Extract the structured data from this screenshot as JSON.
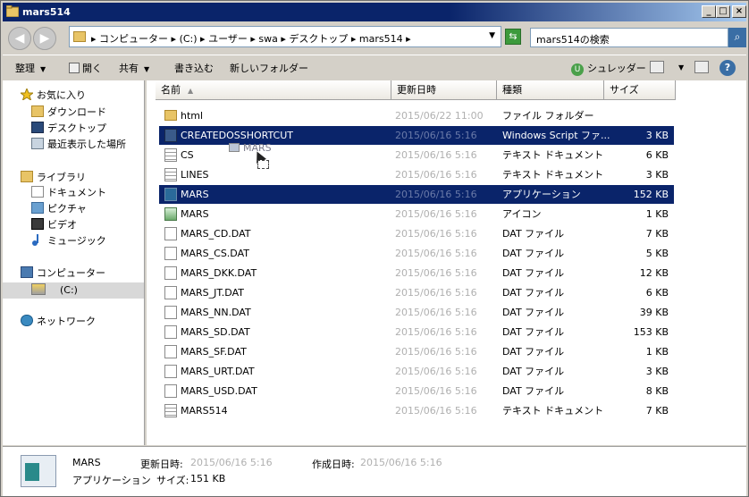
{
  "window": {
    "title": "mars514"
  },
  "titlebar_buttons": {
    "minimize": "_",
    "maximize": "□",
    "close": "×"
  },
  "address": {
    "crumbs": [
      "コンピューター",
      "(C:)",
      "ユーザー",
      "swa",
      "デスクトップ",
      "mars514"
    ],
    "search_placeholder": "mars514の検索"
  },
  "toolbar": {
    "organize": "整理",
    "open": "開く",
    "share": "共有",
    "burn": "書き込む",
    "new_folder": "新しいフォルダー",
    "shredder": "シュレッダー"
  },
  "nav": {
    "favorites": "お気に入り",
    "downloads": "ダウンロード",
    "desktop": "デスクトップ",
    "recent": "最近表示した場所",
    "libraries": "ライブラリ",
    "documents": "ドキュメント",
    "pictures": "ピクチャ",
    "videos": "ビデオ",
    "music": "ミュージック",
    "computer": "コンピューター",
    "drive_c": "(C:)",
    "network": "ネットワーク"
  },
  "columns": {
    "name": "名前",
    "date": "更新日時",
    "type": "種類",
    "size": "サイズ"
  },
  "files": [
    {
      "name": "html",
      "date": "2015/06/22 11:00",
      "type": "ファイル フォルダー",
      "size": "",
      "icon": "folder-icon",
      "selected": false
    },
    {
      "name": "CREATEDOSSHORTCUT",
      "date": "2015/06/16 5:16",
      "type": "Windows Script ファ...",
      "size": "3 KB",
      "icon": "script-icon",
      "selected": true
    },
    {
      "name": "CS",
      "date": "2015/06/16 5:16",
      "type": "テキスト ドキュメント",
      "size": "6 KB",
      "icon": "text-file-icon",
      "selected": false
    },
    {
      "name": "LINES",
      "date": "2015/06/16 5:16",
      "type": "テキスト ドキュメント",
      "size": "3 KB",
      "icon": "text-file-icon",
      "selected": false
    },
    {
      "name": "MARS",
      "date": "2015/06/16 5:16",
      "type": "アプリケーション",
      "size": "152 KB",
      "icon": "application-icon",
      "selected": true
    },
    {
      "name": "MARS",
      "date": "2015/06/16 5:16",
      "type": "アイコン",
      "size": "1 KB",
      "icon": "icon-file-icon",
      "selected": false
    },
    {
      "name": "MARS_CD.DAT",
      "date": "2015/06/16 5:16",
      "type": "DAT ファイル",
      "size": "7 KB",
      "icon": "file-icon",
      "selected": false
    },
    {
      "name": "MARS_CS.DAT",
      "date": "2015/06/16 5:16",
      "type": "DAT ファイル",
      "size": "5 KB",
      "icon": "file-icon",
      "selected": false
    },
    {
      "name": "MARS_DKK.DAT",
      "date": "2015/06/16 5:16",
      "type": "DAT ファイル",
      "size": "12 KB",
      "icon": "file-icon",
      "selected": false
    },
    {
      "name": "MARS_JT.DAT",
      "date": "2015/06/16 5:16",
      "type": "DAT ファイル",
      "size": "6 KB",
      "icon": "file-icon",
      "selected": false
    },
    {
      "name": "MARS_NN.DAT",
      "date": "2015/06/16 5:16",
      "type": "DAT ファイル",
      "size": "39 KB",
      "icon": "file-icon",
      "selected": false
    },
    {
      "name": "MARS_SD.DAT",
      "date": "2015/06/16 5:16",
      "type": "DAT ファイル",
      "size": "153 KB",
      "icon": "file-icon",
      "selected": false
    },
    {
      "name": "MARS_SF.DAT",
      "date": "2015/06/16 5:16",
      "type": "DAT ファイル",
      "size": "1 KB",
      "icon": "file-icon",
      "selected": false
    },
    {
      "name": "MARS_URT.DAT",
      "date": "2015/06/16 5:16",
      "type": "DAT ファイル",
      "size": "3 KB",
      "icon": "file-icon",
      "selected": false
    },
    {
      "name": "MARS_USD.DAT",
      "date": "2015/06/16 5:16",
      "type": "DAT ファイル",
      "size": "8 KB",
      "icon": "file-icon",
      "selected": false
    },
    {
      "name": "MARS514",
      "date": "2015/06/16 5:16",
      "type": "テキスト ドキュメント",
      "size": "7 KB",
      "icon": "text-file-icon",
      "selected": false
    }
  ],
  "drag_label": "MARS",
  "details": {
    "name": "MARS",
    "type": "アプリケーション",
    "modified_label": "更新日時:",
    "modified_value": "2015/06/16 5:16",
    "created_label": "作成日時:",
    "created_value": "2015/06/16 5:16",
    "size_label": "サイズ:",
    "size_value": "151 KB"
  }
}
